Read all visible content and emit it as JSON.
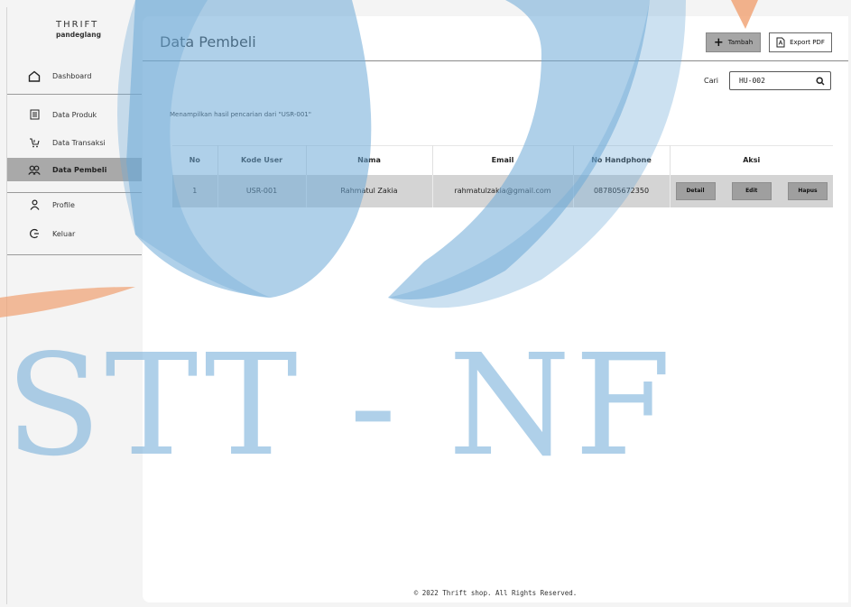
{
  "brand": {
    "name": "THRIFT",
    "sub": "pandeglang"
  },
  "sidebar": {
    "items": [
      {
        "label": "Dashboard",
        "icon": "home-icon"
      },
      {
        "label": "Data Produk",
        "icon": "box-icon"
      },
      {
        "label": "Data Transaksi",
        "icon": "cart-icon"
      },
      {
        "label": "Data Pembeli",
        "icon": "users-icon",
        "active": true
      },
      {
        "label": "Profile",
        "icon": "user-icon"
      },
      {
        "label": "Keluar",
        "icon": "logout-icon"
      }
    ]
  },
  "header": {
    "title": "Data Pembeli",
    "add_label": "Tambah",
    "export_label": "Export PDF"
  },
  "search": {
    "label": "Cari",
    "value": "HU-002"
  },
  "result_text": "Menampilkan hasil pencarian dari \"USR-001\"",
  "table": {
    "columns": [
      "No",
      "Kode User",
      "Nama",
      "Email",
      "No Handphone",
      "Aksi"
    ],
    "rows": [
      {
        "no": "1",
        "kode": "USR-001",
        "nama": "Rahmatul Zakia",
        "email": "rahmatulzakia@gmail.com",
        "hp": "087805672350"
      }
    ],
    "actions": {
      "detail": "Detail",
      "edit": "Edit",
      "hapus": "Hapus"
    }
  },
  "footer": "© 2022 Thrift shop. All Rights Reserved.",
  "watermark": "STT - NF",
  "colors": {
    "watermark_blue": "#6eaad7",
    "watermark_orange": "#f0a070",
    "active_bg": "#a9a9a9",
    "row_bg": "#d4d4d4"
  }
}
